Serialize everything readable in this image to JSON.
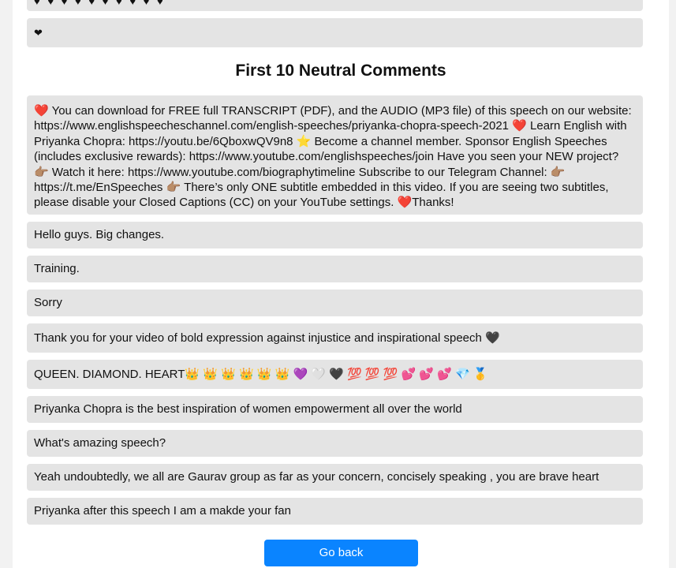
{
  "top_cards": {
    "dots_row": "♥ ♥ ♥ ♥ ♥ ♥ ♥ ♥ ♥ ♥",
    "heart_only": "❤"
  },
  "section": {
    "title": "First 10 Neutral Comments"
  },
  "comments": [
    "❤️ You can download for FREE full TRANSCRIPT (PDF), and the AUDIO (MP3 file) of this speech on our website: https://www.englishspeecheschannel.com/english-speeches/priyanka-chopra-speech-2021 ❤️ Learn English with Priyanka Chopra: https://youtu.be/6QboxwQV9n8 ⭐ Become a channel member. Sponsor English Speeches (includes exclusive rewards): https://www.youtube.com/englishspeeches/join Have you seen your NEW project? 👉🏽 Watch it here: https://www.youtube.com/biographytimeline Subscribe to our Telegram Channel: 👉🏽 https://t.me/EnSpeeches 👉🏽 There’s only ONE subtitle embedded in this video. If you are seeing two subtitles, please disable your Closed Captions (CC) on your YouTube settings. ❤️Thanks!",
    "Hello guys. Big changes.",
    "Training.",
    "Sorry",
    "Thank you for your video of bold expression against injustice and inspirational speech 🖤",
    "QUEEN. DIAMOND. HEART👑 👑 👑 👑 👑 👑 💜 🤍 🖤 💯 💯 💯 💕 💕 💕 💎 🥇",
    "Priyanka Chopra is the best inspiration of women empowerment all over the world",
    "What's amazing speech?",
    "Yeah undoubtedly, we all are Gaurav group as far as your concern, concisely speaking , you are brave heart",
    "Priyanka after this speech I am a makde your fan"
  ],
  "actions": {
    "go_back_label": "Go back"
  }
}
